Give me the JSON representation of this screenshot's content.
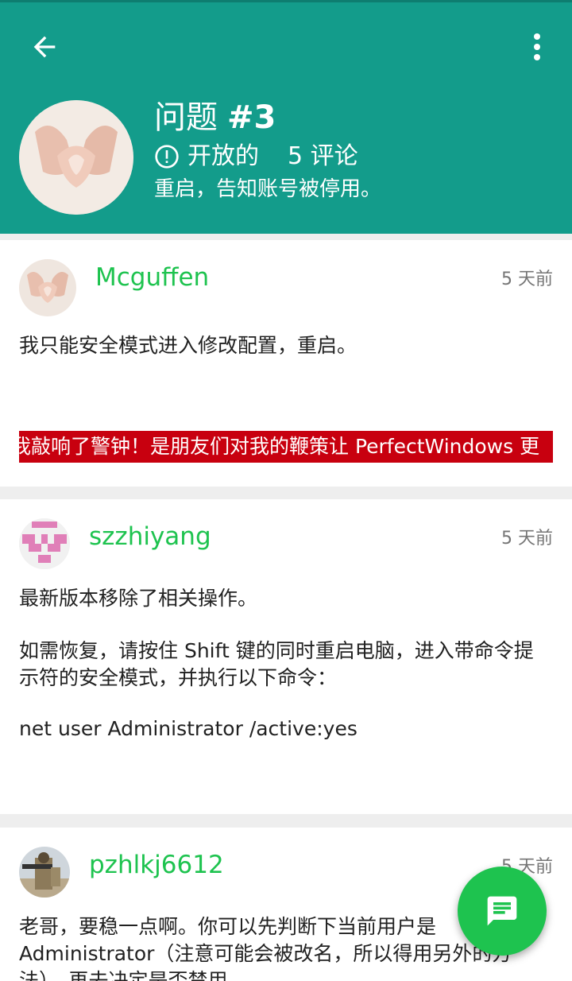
{
  "header": {
    "title_prefix": "问题",
    "title_number": "#3",
    "status": "开放的",
    "comments": "5 评论",
    "description": "重启，告知账号被停用。",
    "bg_color": "#139c8b"
  },
  "comments": [
    {
      "username": "Mcguffen",
      "time": "5 天前",
      "text": "我只能安全模式进入修改配置，重启。",
      "banner": "我敲响了警钟！是朋友们对我的鞭策让 PerfectWindows 更"
    },
    {
      "username": "szzhiyang",
      "time": "5 天前",
      "line1": "最新版本移除了相关操作。",
      "line2": "如需恢复，请按住 Shift 键的同时重启电脑，进入带命令提示符的安全模式，并执行以下命令：",
      "line3": "net user Administrator /active:yes"
    },
    {
      "username": "pzhlkj6612",
      "time": "5 天前",
      "text": "老哥，要稳一点啊。你可以先判断下当前用户是Administrator（注意可能会被改名，所以得用另外的方法），再去决定是否禁用"
    }
  ],
  "icons": {
    "back": "arrow-left-icon",
    "more": "more-vert-icon",
    "status": "info-circle-icon",
    "fab": "chat-icon"
  },
  "colors": {
    "accent_green": "#1ec34f",
    "banner_red": "#c8000f"
  }
}
